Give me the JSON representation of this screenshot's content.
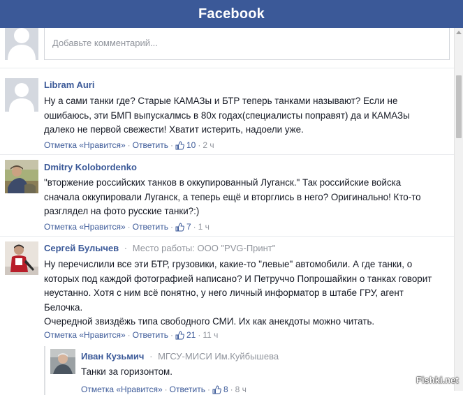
{
  "header": {
    "title": "Facebook"
  },
  "compose": {
    "placeholder": "Добавьте комментарий..."
  },
  "labels": {
    "like": "Отметка «Нравится»",
    "reply": "Ответить",
    "separator": "·"
  },
  "comments": [
    {
      "author": "Libram Auri",
      "job": "",
      "text_lines": [
        "Ну а сами танки где? Старые КАМАЗы и БТР теперь танками называют? Если не",
        "ошибаюсь, эти БМП выпускалмсь в 80х годах(специалисты поправят) да и КАМАЗы",
        "далеко не первой свежести! Хватит истерить, надоели уже."
      ],
      "likes": "10",
      "time": "2 ч"
    },
    {
      "author": "Dmitry Kolobordenko",
      "job": "",
      "text_lines": [
        "\"вторжение российских танков в оккупированный Луганск.\" Так российские войска",
        "сначала оккупировали Луганск, а теперь ещё и вторглись в него? Оригинально! Кто-то",
        "разглядел на фото русские танки?:)"
      ],
      "likes": "7",
      "time": "1 ч"
    },
    {
      "author": "Сергей Булычев",
      "job": "Место работы: ООО \"PVG-Принт\"",
      "text_lines": [
        "Ну перечислили все эти БТР, грузовики, какие-то \"левые\" автомобили. А где танки, о",
        "которых под каждой фотографией написано? И Петруччо Попрошайкин о танках говорит",
        "неустанно. Хотя с ним всё понятно, у него личный информатор в штабе ГРУ, агент",
        "Белочка.",
        "Очередной звиздёжь типа свободного СМИ. Их как анекдоты можно читать."
      ],
      "likes": "21",
      "time": "11 ч"
    }
  ],
  "reply": {
    "author": "Иван Кузьмич",
    "job": "МГСУ-МИСИ Им.Куйбышева",
    "text": "Танки за горизонтом.",
    "likes": "8",
    "time": "8 ч"
  },
  "watermark": "Fishki.net",
  "colors": {
    "brand": "#3b5998",
    "meta": "#90949c",
    "text": "#141823"
  }
}
